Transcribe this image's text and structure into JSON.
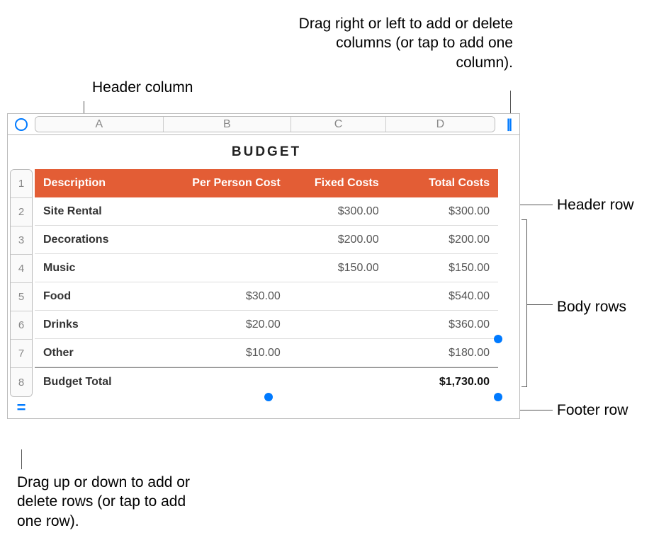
{
  "annotations": {
    "header_column": "Header column",
    "col_handle": "Drag right or left to add or delete columns (or tap to add one column).",
    "header_row": "Header row",
    "body_rows": "Body rows",
    "footer_row": "Footer row",
    "row_handle": "Drag up or down to add or delete rows (or tap to add one row)."
  },
  "table": {
    "title": "BUDGET",
    "col_labels": [
      "A",
      "B",
      "C",
      "D"
    ],
    "row_labels": [
      "1",
      "2",
      "3",
      "4",
      "5",
      "6",
      "7",
      "8"
    ],
    "headers": {
      "description": "Description",
      "per_person": "Per Person Cost",
      "fixed": "Fixed Costs",
      "total": "Total Costs"
    },
    "rows": [
      {
        "description": "Site Rental",
        "per_person": "",
        "fixed": "$300.00",
        "total": "$300.00"
      },
      {
        "description": "Decorations",
        "per_person": "",
        "fixed": "$200.00",
        "total": "$200.00"
      },
      {
        "description": "Music",
        "per_person": "",
        "fixed": "$150.00",
        "total": "$150.00"
      },
      {
        "description": "Food",
        "per_person": "$30.00",
        "fixed": "",
        "total": "$540.00"
      },
      {
        "description": "Drinks",
        "per_person": "$20.00",
        "fixed": "",
        "total": "$360.00"
      },
      {
        "description": "Other",
        "per_person": "$10.00",
        "fixed": "",
        "total": "$180.00"
      }
    ],
    "footer": {
      "description": "Budget Total",
      "per_person": "",
      "fixed": "",
      "total": "$1,730.00"
    }
  },
  "icons": {
    "col_handle": "||",
    "row_handle": "="
  }
}
